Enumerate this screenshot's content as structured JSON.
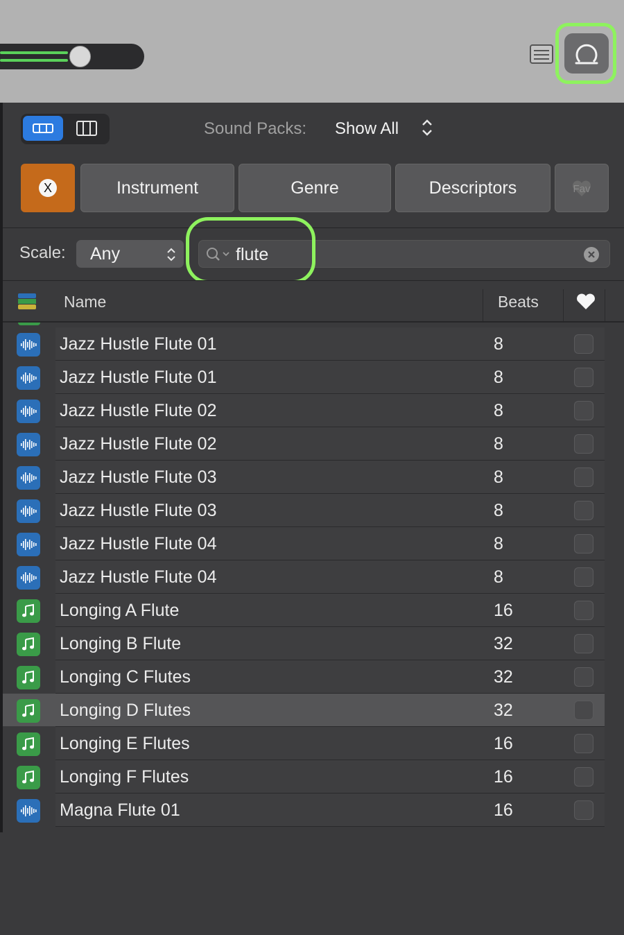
{
  "toolbar": {
    "volume_icon": "volume-slider",
    "notes_icon": "notes-icon",
    "loop_browser_icon": "loop-icon",
    "highlight_color": "#8ef25e"
  },
  "browser": {
    "sound_packs_label": "Sound Packs:",
    "sound_packs_value": "Show All",
    "filters": {
      "clear_label": "X",
      "instrument": "Instrument",
      "genre": "Genre",
      "descriptors": "Descriptors",
      "favorites": "Fav"
    },
    "scale_label": "Scale:",
    "scale_value": "Any",
    "search_value": "flute",
    "table": {
      "col_name": "Name",
      "col_beats": "Beats"
    },
    "rows": [
      {
        "type": "audio",
        "name": "Jazz Hustle Flute 01",
        "beats": "8"
      },
      {
        "type": "audio",
        "name": "Jazz Hustle Flute 01",
        "beats": "8"
      },
      {
        "type": "audio",
        "name": "Jazz Hustle Flute 02",
        "beats": "8"
      },
      {
        "type": "audio",
        "name": "Jazz Hustle Flute 02",
        "beats": "8"
      },
      {
        "type": "audio",
        "name": "Jazz Hustle Flute 03",
        "beats": "8"
      },
      {
        "type": "audio",
        "name": "Jazz Hustle Flute 03",
        "beats": "8"
      },
      {
        "type": "audio",
        "name": "Jazz Hustle Flute 04",
        "beats": "8"
      },
      {
        "type": "audio",
        "name": "Jazz Hustle Flute 04",
        "beats": "8"
      },
      {
        "type": "midi",
        "name": "Longing A Flute",
        "beats": "16"
      },
      {
        "type": "midi",
        "name": "Longing B Flute",
        "beats": "32"
      },
      {
        "type": "midi",
        "name": "Longing C Flutes",
        "beats": "32"
      },
      {
        "type": "midi",
        "name": "Longing D Flutes",
        "beats": "32",
        "selected": true
      },
      {
        "type": "midi",
        "name": "Longing E Flutes",
        "beats": "16"
      },
      {
        "type": "midi",
        "name": "Longing F Flutes",
        "beats": "16"
      },
      {
        "type": "audio",
        "name": "Magna Flute 01",
        "beats": "16"
      }
    ]
  },
  "colors": {
    "audio_loop": "#2b6fb8",
    "midi_loop": "#3a9b48",
    "clear_filter": "#c56a1b",
    "active_view": "#2c7be0"
  }
}
